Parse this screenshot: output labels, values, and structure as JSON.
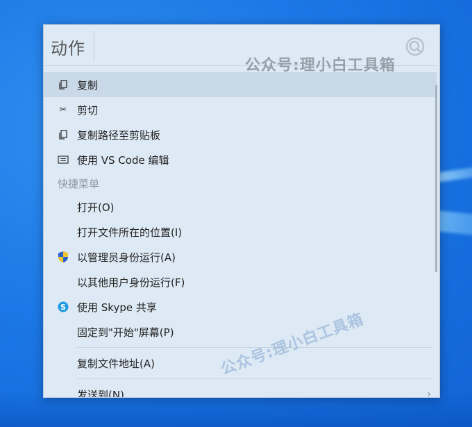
{
  "panel": {
    "title": "动作"
  },
  "menu": {
    "copy": "复制",
    "cut": "剪切",
    "copy_path": "复制路径至剪贴板",
    "vscode": "使用 VS Code 编辑",
    "quick_menu_label": "快捷菜单",
    "open": "打开(O)",
    "open_location": "打开文件所在的位置(I)",
    "run_as_admin": "以管理员身份运行(A)",
    "run_as_other": "以其他用户身份运行(F)",
    "skype_share": "使用 Skype 共享",
    "pin_start": "固定到\"开始\"屏幕(P)",
    "copy_file_address": "复制文件地址(A)",
    "send_to": "发送到(N)"
  },
  "watermark": {
    "text1": "公众号:理小白工具箱",
    "text2": "公众号:理小白工具箱"
  },
  "colors": {
    "panel_bg": "#dde9f4",
    "selected_bg": "#c9d9e7",
    "desktop_blue": "#1c78e6"
  }
}
